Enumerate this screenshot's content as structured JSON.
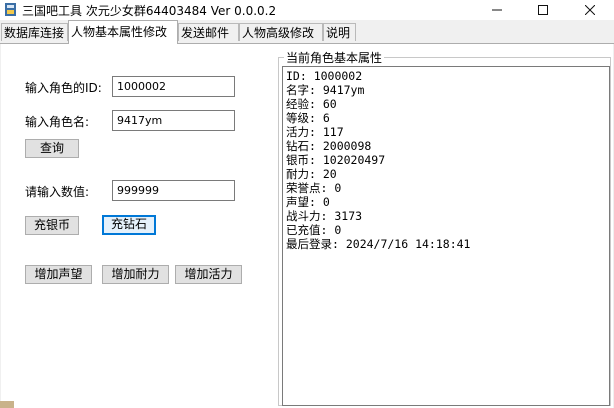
{
  "window": {
    "title": "三国吧工具  次元少女群64403484  Ver 0.0.0.2",
    "minimize_icon": "minimize-icon",
    "maximize_icon": "maximize-icon",
    "close_icon": "close-icon"
  },
  "tabs": [
    {
      "label": "数据库连接",
      "active": false
    },
    {
      "label": "人物基本属性修改",
      "active": true
    },
    {
      "label": "发送邮件",
      "active": false
    },
    {
      "label": "人物高级修改",
      "active": false
    },
    {
      "label": "说明",
      "active": false
    }
  ],
  "form": {
    "role_id_label": "输入角色的ID:",
    "role_id_value": "1000002",
    "role_name_label": "输入角色名:",
    "role_name_value": "9417ym",
    "query_button": "查询",
    "amount_label": "请输入数值:",
    "amount_value": "999999",
    "add_silver_button": "充银币",
    "add_diamond_button": "充钻石",
    "add_prestige_button": "增加声望",
    "add_stamina_button": "增加耐力",
    "add_vitality_button": "增加活力"
  },
  "info_panel": {
    "caption": "当前角色基本属性",
    "lines": [
      "ID: 1000002",
      "名字: 9417ym",
      "经验: 60",
      "等级: 6",
      "活力: 117",
      "钻石: 2000098",
      "银币: 102020497",
      "耐力: 20",
      "荣誉点: 0",
      "声望: 0",
      "战斗力: 3173",
      "已充值: 0",
      "最后登录: 2024/7/16 14:18:41"
    ]
  }
}
